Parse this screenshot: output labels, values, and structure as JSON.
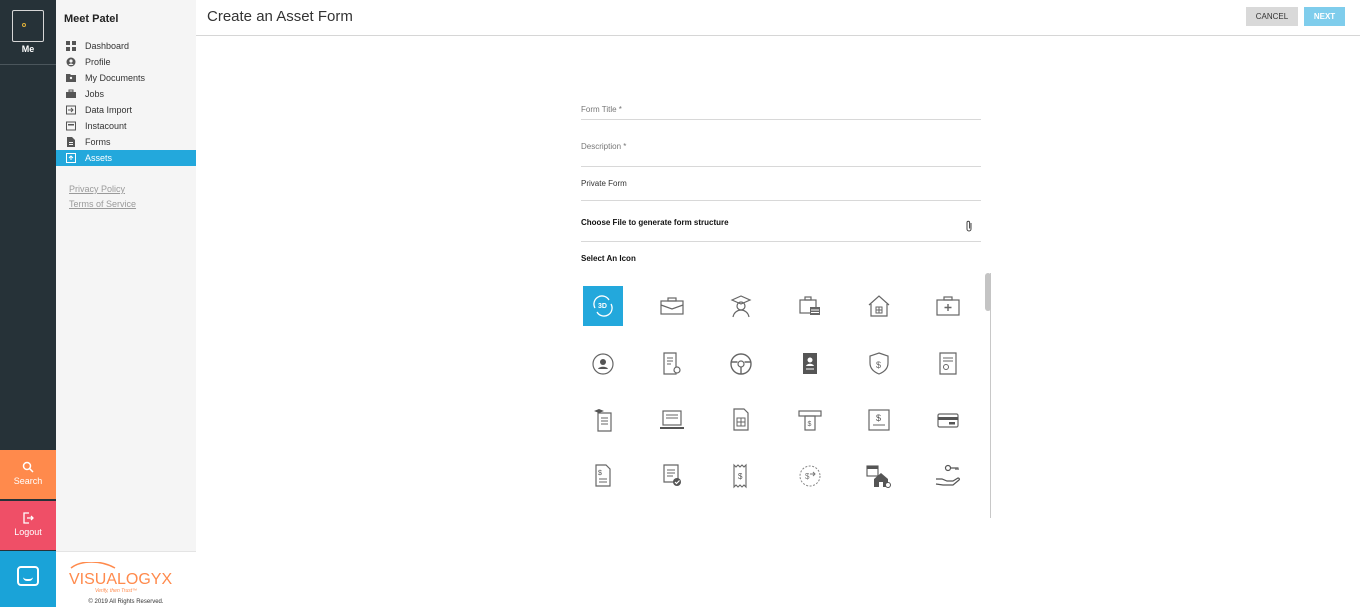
{
  "app": {
    "brand": "VISUALOGYX",
    "tagline": "Verify, then Trust™"
  },
  "rail": {
    "me_label": "Me",
    "search_label": "Search",
    "logout_label": "Logout"
  },
  "sidebar": {
    "user_name": "Meet Patel",
    "items": [
      {
        "label": "Dashboard",
        "icon": "dashboard-icon"
      },
      {
        "label": "Profile",
        "icon": "profile-icon"
      },
      {
        "label": "My Documents",
        "icon": "documents-icon"
      },
      {
        "label": "Jobs",
        "icon": "briefcase-icon"
      },
      {
        "label": "Data Import",
        "icon": "import-icon"
      },
      {
        "label": "Instacount",
        "icon": "instacount-icon"
      },
      {
        "label": "Forms",
        "icon": "forms-icon"
      },
      {
        "label": "Assets",
        "icon": "assets-icon",
        "active": true
      }
    ],
    "privacy": "Privacy Policy",
    "terms": "Terms of Service",
    "copyright": "© 2019 All Rights Reserved."
  },
  "header": {
    "title": "Create an Asset Form",
    "cancel_label": "CANCEL",
    "next_label": "NEXT"
  },
  "form": {
    "title_label": "Form Title *",
    "description_label": "Description *",
    "private_label": "Private Form",
    "file_label": "Choose File to generate form structure",
    "select_icon_label": "Select An Icon",
    "icons": [
      [
        "3d-rotate-icon",
        "briefcase-icon",
        "graduate-icon",
        "briefcase-money-icon",
        "house-icon",
        "first-aid-kit-icon"
      ],
      [
        "user-circle-icon",
        "document-search-icon",
        "steering-wheel-icon",
        "contact-book-icon",
        "shield-dollar-icon",
        "certificate-icon"
      ],
      [
        "diploma-document-icon",
        "laptop-icon",
        "spreadsheet-icon",
        "atm-icon",
        "dollar-statement-icon",
        "credit-card-icon"
      ],
      [
        "invoice-dollar-icon",
        "document-check-icon",
        "receipt-icon",
        "money-exchange-icon",
        "calendar-house-icon",
        "hand-key-icon"
      ]
    ],
    "selected_icon": "3d-rotate-icon"
  },
  "colors": {
    "rail": "#263238",
    "accent": "#23a8dc",
    "search": "#ff8a4c",
    "logout": "#ef4f67",
    "next": "#7fcdec"
  }
}
